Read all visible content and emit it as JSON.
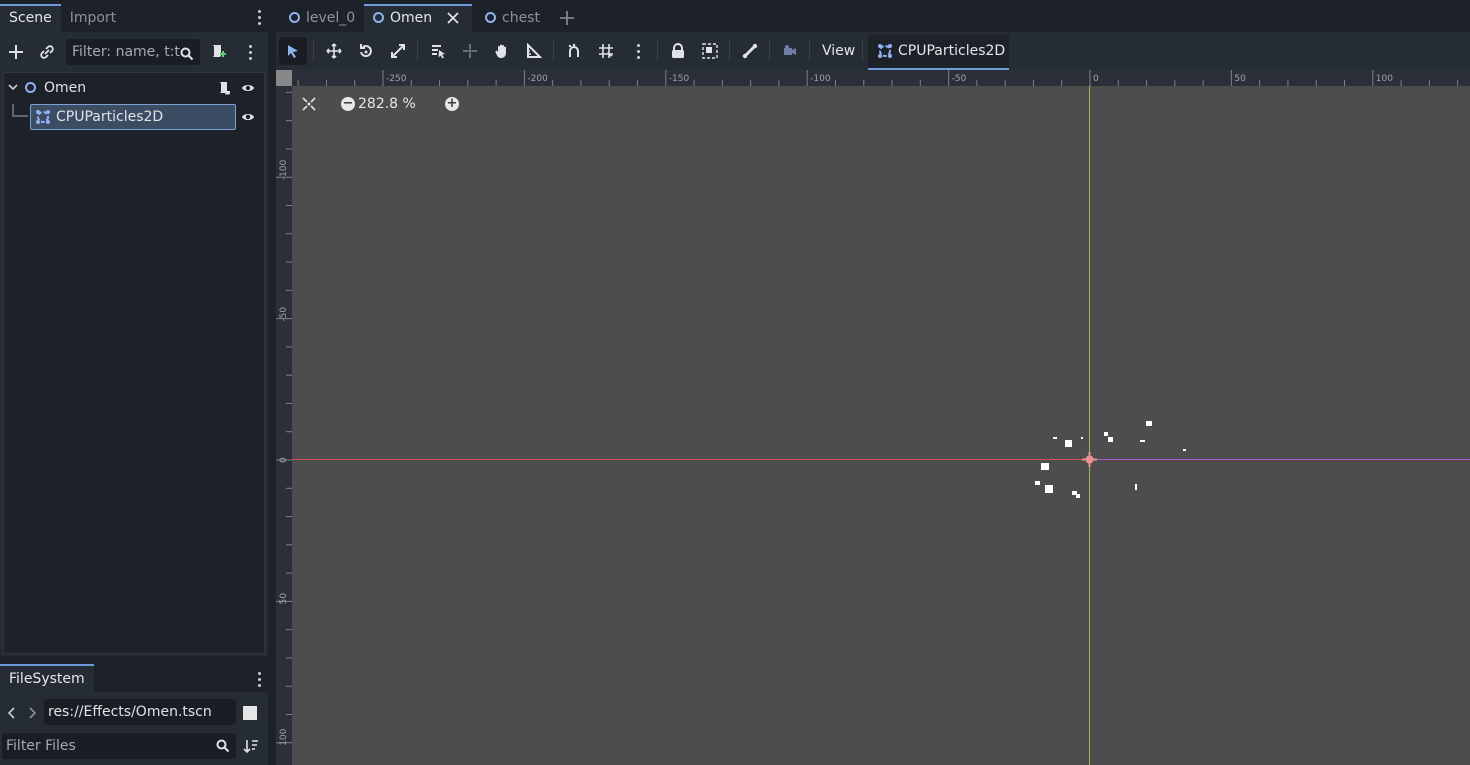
{
  "dock": {
    "tabs": [
      {
        "label": "Scene"
      },
      {
        "label": "Import"
      }
    ],
    "filter_placeholder": "Filter: name, t:t",
    "tree": [
      {
        "label": "Omen"
      },
      {
        "label": "CPUParticles2D"
      }
    ]
  },
  "filesystem": {
    "tab_label": "FileSystem",
    "path": "res://Effects/Omen.tscn",
    "filter_placeholder": "Filter Files"
  },
  "editor": {
    "scene_tabs": [
      {
        "label": "level_0"
      },
      {
        "label": "Omen"
      },
      {
        "label": "chest"
      }
    ],
    "active_tab_index": 1,
    "view_label": "View",
    "node_context_label": "CPUParticles2D",
    "zoom_label": "282.8 %"
  },
  "rulers": {
    "h_labels": [
      "-250",
      "-200",
      "-150",
      "-100",
      "-50",
      "0",
      "50",
      "100"
    ],
    "v_labels": [
      "-100",
      "-50",
      "0",
      "50",
      "100"
    ]
  },
  "colors": {
    "accent": "#6f9ade",
    "node_icon": "#8eb1f0",
    "axis_x": "#d64d4d",
    "axis_y": "#8fc33c",
    "viewport_bg": "#4d4d4d",
    "origin_marker": "#f0908c"
  }
}
